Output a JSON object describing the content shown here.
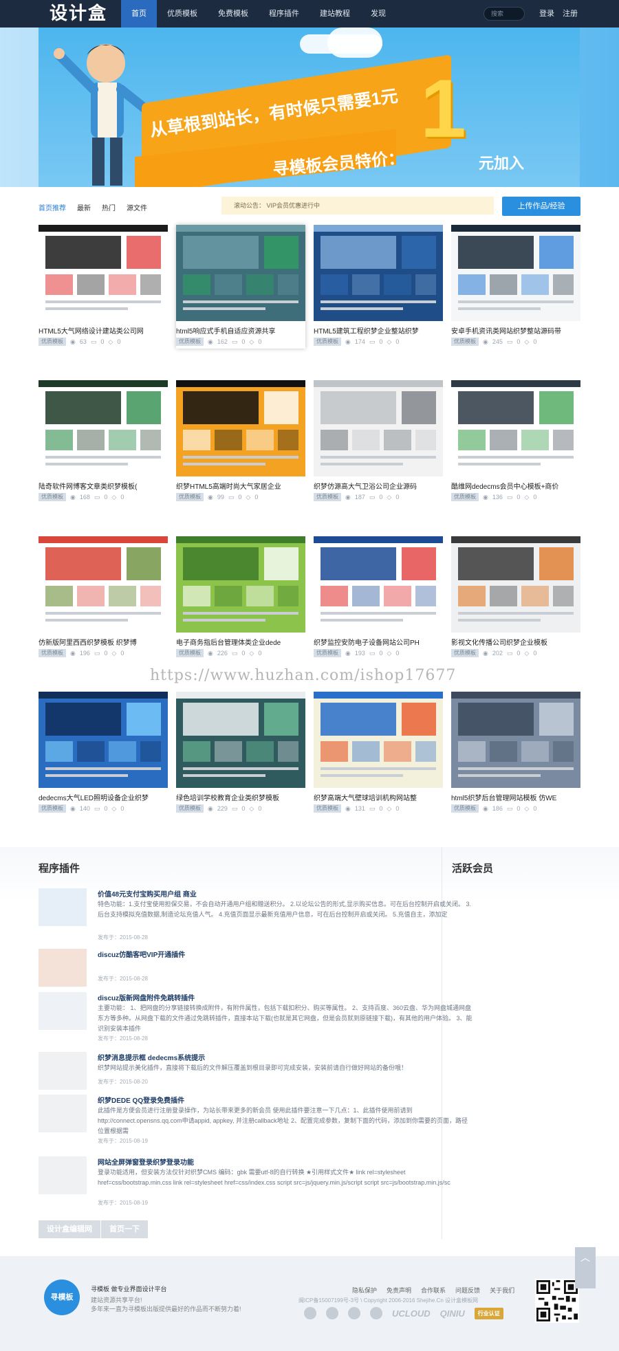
{
  "header": {
    "logo": "设计盒",
    "nav": [
      {
        "label": "首页",
        "active": true
      },
      {
        "label": "优质模板",
        "active": false
      },
      {
        "label": "免费模板",
        "active": false
      },
      {
        "label": "程序插件",
        "active": false
      },
      {
        "label": "建站教程",
        "active": false
      },
      {
        "label": "发现",
        "active": false
      }
    ],
    "search_placeholder": "搜索",
    "login": "登录",
    "register": "注册"
  },
  "banner": {
    "line1": "从草根到站长，有时候只需要1元",
    "line2": "寻模板会员特价：",
    "big": "1",
    "tail": "元加入"
  },
  "filters": {
    "tabs": [
      {
        "label": "首页推荐",
        "active": true
      },
      {
        "label": "最新",
        "active": false
      },
      {
        "label": "热门",
        "active": false
      },
      {
        "label": "源文件",
        "active": false
      }
    ],
    "notice": "滚动公告：   VIP会员优惠进行中",
    "upload": "上传作品/经验"
  },
  "cards": [
    {
      "title": "HTML5大气网络设计建站类公司网",
      "tag": "优质模板",
      "views": "63",
      "comments": "0",
      "likes": "0"
    },
    {
      "title": "html5响应式手机自适应资源共享",
      "tag": "优质模板",
      "views": "162",
      "comments": "0",
      "likes": "0"
    },
    {
      "title": "HTML5建筑工程织梦企业整站织梦",
      "tag": "优质模板",
      "views": "174",
      "comments": "0",
      "likes": "0"
    },
    {
      "title": "安卓手机资讯类网站织梦整站源码带",
      "tag": "优质模板",
      "views": "245",
      "comments": "0",
      "likes": "0"
    },
    {
      "title": "陆奇软件网博客文章类织梦模板(",
      "tag": "优质模板",
      "views": "168",
      "comments": "0",
      "likes": "0"
    },
    {
      "title": "织梦HTML5高端时尚大气家居企业",
      "tag": "优质模板",
      "views": "99",
      "comments": "0",
      "likes": "0"
    },
    {
      "title": "织梦仿源高大气卫浴公司企业源码",
      "tag": "优质模板",
      "views": "187",
      "comments": "0",
      "likes": "0"
    },
    {
      "title": "酷维网dedecms会员中心模板+商价",
      "tag": "优质模板",
      "views": "136",
      "comments": "0",
      "likes": "0"
    },
    {
      "title": "仿新版阿里西西织梦模板 织梦博",
      "tag": "优质模板",
      "views": "196",
      "comments": "0",
      "likes": "0"
    },
    {
      "title": "电子商务指后台管理体类企业dede",
      "tag": "优质模板",
      "views": "226",
      "comments": "0",
      "likes": "0"
    },
    {
      "title": "织梦监控安防电子设备网站公司PH",
      "tag": "优质模板",
      "views": "193",
      "comments": "0",
      "likes": "0"
    },
    {
      "title": "影视文化传播公司织梦企业模板",
      "tag": "优质模板",
      "views": "202",
      "comments": "0",
      "likes": "0"
    },
    {
      "title": "dedecms大气LED照明设备企业织梦",
      "tag": "优质模板",
      "views": "140",
      "comments": "0",
      "likes": "0"
    },
    {
      "title": "绿色培训学校教育企业类织梦模板",
      "tag": "优质模板",
      "views": "229",
      "comments": "0",
      "likes": "0"
    },
    {
      "title": "织梦高端大气壁球培训机构网站整",
      "tag": "优质模板",
      "views": "131",
      "comments": "0",
      "likes": "0"
    },
    {
      "title": "html5织梦后台管理网站模板 仿WE",
      "tag": "优质模板",
      "views": "186",
      "comments": "0",
      "likes": "0"
    }
  ],
  "watermark": "https://www.huzhan.com/ishop17677",
  "plugins": {
    "section_title": "程序插件",
    "side_title": "活跃会员",
    "items": [
      {
        "title": "价值48元支付宝购买用户组 商业",
        "desc": "特色功能：1.支付宝使用担保交易，不会自动开通用户组和赠送积分。 2.以论坛公告的形式,显示购买信息。可在后台控制开启或关闭。 3.后台支持模拟充值数据,制造论坛充值人气。 4.充值页面显示最新充值用户信息，可在后台控制开启或关闭。 5.充值自主，添加定",
        "date": "发布于：2015-08-28"
      },
      {
        "title": "discuz仿酷客吧VIP开通插件",
        "desc": "",
        "date": "发布于：2015-08-28"
      },
      {
        "title": "discuz版新网盘附件免跳转插件",
        "desc": "主要功能： 1、把网盘的分享链接转换成附件，有附件属性，包括下载扣积分、购买等属性。 2、支持百度、360云盘、华为网盘城通网盘东方等多种。从网盘下载的文件通过免跳转插件，直接本站下载(也就是其它网盘，但是会员就到原链接下载)，有其他的用户体验。 3、能识别安装本插件",
        "date": "发布于：2015-08-28"
      },
      {
        "title": "织梦消息提示框 dedecms系统提示",
        "desc": "织梦网站提示美化插件，直接将下载后的文件解压覆盖到根目录即可完成安装，安装前请自行做好网站的备份哦！",
        "date": "发布于：2015-08-20"
      },
      {
        "title": "织梦DEDE QQ登录免费插件",
        "desc": "此插件是方便会员进行注册登录操作，为站长带来更多的新会员 使用此插件要注意一下几点：1、此插件使用前请到 http://connect.opensns.qq.com申请appid, appkey, 并注册callback地址 2、配置完成参数，复制下面的代码，添加到你需要的页面，路径位置根据需",
        "date": "发布于：2015-08-19"
      },
      {
        "title": "网站全屏弹窗登录织梦登录功能",
        "desc": "登录功能适用，但安装方法仅针对织梦CMS 编码：gbk 需要utf-8的自行转换 ★引用样式文件★ link rel=stylesheet href=css/bootstrap.min.css link rel=stylesheet href=css/index.css script src=js/jquery.min.js/script script src=js/bootstrap.min.js/sc",
        "date": "发布于：2015-08-19"
      }
    ],
    "pager_home": "设计盒编辑网",
    "pager_next": "首页一下"
  },
  "footer": {
    "logo": "寻模板",
    "slogan": "寻模板  做专业界面设计平台",
    "sub1": "建站资源共享平台!",
    "sub2": "多年来一直为寻模板出版提供最好的作品而不断努力着!",
    "links": [
      "隐私保护",
      "免责声明",
      "合作联系",
      "问题反馈",
      "关于我们"
    ],
    "icp": "闽ICP备15007199号-3号 \\ Copyright 2006-2016 Shejihe.Cn 设计盒模板网",
    "brands": [
      "UCLOUD",
      "QINIU"
    ],
    "badge": "行业认证"
  },
  "colors": {
    "accent": "#2b8fe0",
    "header": "#1c2b3f",
    "banner_orange": "#f7a418"
  }
}
